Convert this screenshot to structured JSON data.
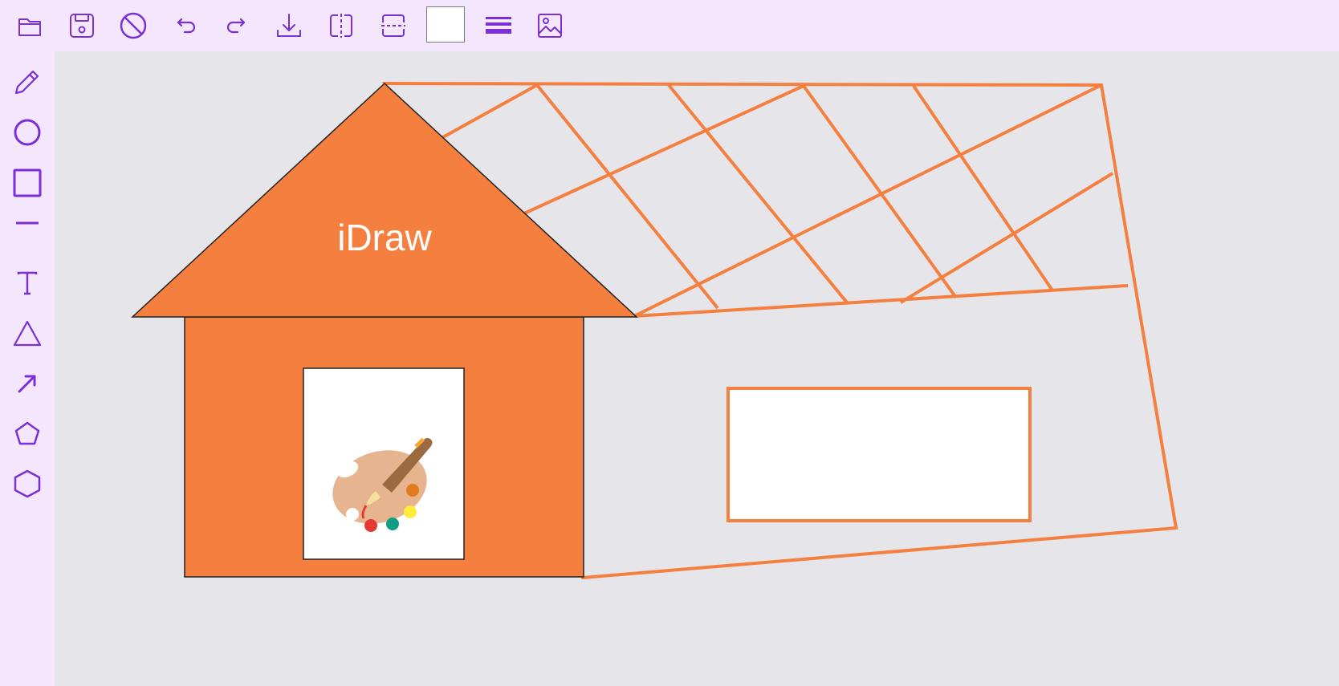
{
  "colors": {
    "accent": "#7b2fd6",
    "toolbar_bg": "#f3e6fd",
    "canvas_bg": "#e5e5ea",
    "shape_fill": "#f57f3e",
    "shape_stroke": "#f57f3e"
  },
  "toolbar": {
    "buttons": [
      {
        "name": "open-folder-icon"
      },
      {
        "name": "save-icon"
      },
      {
        "name": "clear-icon"
      },
      {
        "name": "undo-icon"
      },
      {
        "name": "redo-icon"
      },
      {
        "name": "download-icon"
      },
      {
        "name": "flip-horizontal-icon"
      },
      {
        "name": "flip-vertical-icon"
      },
      {
        "name": "color-swatch",
        "value": "#ffffff"
      },
      {
        "name": "line-width-icon"
      },
      {
        "name": "insert-image-icon"
      }
    ]
  },
  "sidebar": {
    "tools": [
      "pencil-icon",
      "circle-icon",
      "rectangle-icon",
      "line-icon",
      "text-icon",
      "triangle-icon",
      "arrow-icon",
      "pentagon-icon",
      "hexagon-icon"
    ]
  },
  "canvas": {
    "text_label": "iDraw",
    "image_icon": "paint-palette-icon"
  }
}
